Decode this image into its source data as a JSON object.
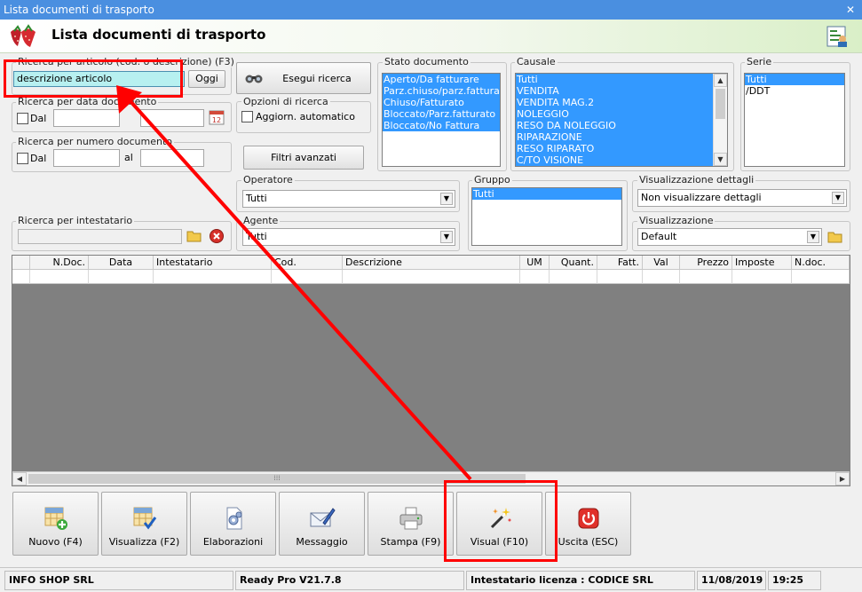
{
  "window": {
    "title": "Lista documenti di trasporto",
    "close_glyph": "✕"
  },
  "header": {
    "title": "Lista documenti di trasporto",
    "logo_icon": "strawberry-logo-icon",
    "right_icon": "user-report-icon"
  },
  "search_article": {
    "label": "Ricerca per articolo (cod. o descrizione) (F3)",
    "value": "descrizione articolo",
    "today_button": "Oggi"
  },
  "search_date": {
    "label": "Ricerca per data documento",
    "from_label": "Dal",
    "from_value": "",
    "to_value": ""
  },
  "search_number": {
    "label": "Ricerca per numero documento",
    "from_label": "Dal",
    "to_label": "al",
    "from_value": "",
    "to_value": ""
  },
  "search_holder": {
    "label": "Ricerca per intestatario",
    "value": ""
  },
  "run_search": {
    "label": "Esegui ricerca"
  },
  "search_options": {
    "label": "Opzioni di ricerca",
    "auto_update_label": "Aggiorn. automatico"
  },
  "advanced_filters": {
    "label": "Filtri avanzati"
  },
  "doc_status": {
    "label": "Stato documento",
    "items": [
      "Aperto/Da fatturare",
      "Parz.chiuso/parz.fatturato",
      "Chiuso/Fatturato",
      "Bloccato/Parz.fatturato",
      "Bloccato/No Fattura"
    ]
  },
  "causale": {
    "label": "Causale",
    "items": [
      "Tutti",
      "VENDITA",
      "VENDITA MAG.2",
      "NOLEGGIO",
      "RESO DA NOLEGGIO",
      "RIPARAZIONE",
      "RESO RIPARATO",
      "C/TO VISIONE"
    ]
  },
  "serie": {
    "label": "Serie",
    "items": [
      "Tutti",
      "/DDT"
    ]
  },
  "operatore": {
    "label": "Operatore",
    "value": "Tutti"
  },
  "agente": {
    "label": "Agente",
    "value": "Tutti"
  },
  "gruppo": {
    "label": "Gruppo",
    "items": [
      "Tutti"
    ]
  },
  "detail_view": {
    "label": "Visualizzazione dettagli",
    "value": "Non visualizzare dettagli"
  },
  "view": {
    "label": "Visualizzazione",
    "value": "Default"
  },
  "table": {
    "columns": [
      "",
      "N.Doc.",
      "Data",
      "Intestatario",
      "Cod.",
      "Descrizione",
      "UM",
      "Quant.",
      "Fatt.",
      "Val",
      "Prezzo",
      "Imposte",
      "N.doc."
    ]
  },
  "buttons": {
    "new": "Nuovo (F4)",
    "view": "Visualizza (F2)",
    "processing": "Elaborazioni",
    "message": "Messaggio",
    "print": "Stampa (F9)",
    "visual": "Visual (F10)",
    "exit": "Uscita (ESC)"
  },
  "status_bar": {
    "company": "INFO SHOP SRL",
    "version": "Ready Pro V21.7.8",
    "license": "Intestatario licenza : CODICE SRL",
    "date": "11/08/2019",
    "time": "19:25"
  },
  "colors": {
    "titlebar": "#4a8fe0",
    "selection": "#3399ff",
    "highlight": "#ff0000",
    "input_highlight": "#b7f0f0"
  }
}
